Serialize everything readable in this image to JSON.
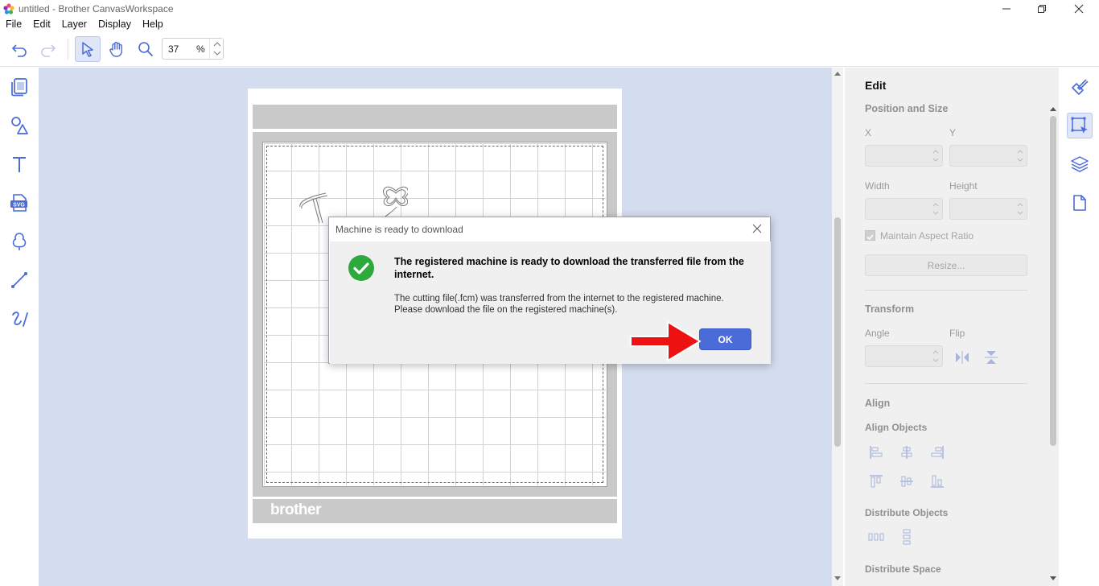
{
  "window": {
    "title": "untitled - Brother CanvasWorkspace"
  },
  "menu": {
    "items": [
      {
        "label": "File"
      },
      {
        "label": "Edit"
      },
      {
        "label": "Layer"
      },
      {
        "label": "Display"
      },
      {
        "label": "Help"
      }
    ]
  },
  "toolbar": {
    "zoom_value": "37",
    "zoom_unit": "%",
    "icons": [
      "undo-icon",
      "redo-icon",
      "select-pointer-icon",
      "hand-pan-icon",
      "zoom-magnifier-icon"
    ],
    "active_tool": "select-pointer-icon"
  },
  "left_tools": {
    "icons": [
      "pages-icon",
      "shapes-icon",
      "text-icon",
      "svg-import-icon",
      "pattern-icon",
      "line-icon",
      "draw-tool-icon"
    ]
  },
  "canvas": {
    "brand": "brother"
  },
  "dialog": {
    "title": "Machine is ready to download",
    "heading": "The registered machine is ready to download the transferred file from the internet.",
    "message_line1": "The cutting file(.fcm) was transferred from the internet to the registered machine.",
    "message_line2": "Please download the file on the registered machine(s).",
    "ok_label": "OK",
    "status_icon": "success-check-icon"
  },
  "edit_panel": {
    "title": "Edit",
    "position_size": {
      "section": "Position and Size",
      "x_label": "X",
      "y_label": "Y",
      "width_label": "Width",
      "height_label": "Height",
      "maintain_aspect_label": "Maintain Aspect Ratio",
      "maintain_aspect_checked": true,
      "resize_label": "Resize..."
    },
    "transform": {
      "section": "Transform",
      "angle_label": "Angle",
      "flip_label": "Flip"
    },
    "align": {
      "section": "Align",
      "align_objects_label": "Align Objects",
      "distribute_objects_label": "Distribute Objects",
      "distribute_space_label": "Distribute Space"
    }
  },
  "right_icons": {
    "icons": [
      "paint-brush-icon",
      "edit-select-icon",
      "layers-icon",
      "page-icon"
    ],
    "active": "edit-select-icon"
  },
  "colors": {
    "accent": "#4a6bd8",
    "canvas_bg": "#d4dcef",
    "success": "#2eaa3c",
    "arrow": "#ee1111"
  }
}
